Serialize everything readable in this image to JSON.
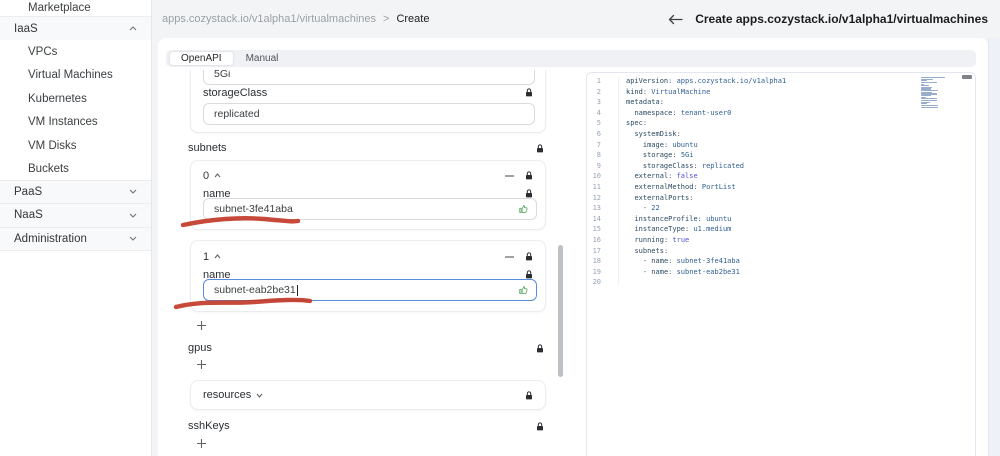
{
  "topbar": {
    "breadcrumb_path": "apps.cozystack.io/v1alpha1/virtualmachines",
    "breadcrumb_separator": ">",
    "breadcrumb_current": "Create",
    "back_icon": "arrow-left",
    "title": "Create apps.cozystack.io/v1alpha1/virtualmachines"
  },
  "sidebar": {
    "items": [
      {
        "label": "Marketplace",
        "kind": "item",
        "divider": true
      },
      {
        "label": "IaaS",
        "kind": "section",
        "chevron": "up",
        "divider": false
      },
      {
        "label": "VPCs",
        "kind": "item",
        "divider": false
      },
      {
        "label": "Virtual Machines",
        "kind": "item",
        "divider": false
      },
      {
        "label": "Kubernetes",
        "kind": "item",
        "divider": false
      },
      {
        "label": "VM Instances",
        "kind": "item",
        "divider": false
      },
      {
        "label": "VM Disks",
        "kind": "item",
        "divider": false
      },
      {
        "label": "Buckets",
        "kind": "item",
        "divider": true
      },
      {
        "label": "PaaS",
        "kind": "section",
        "chevron": "down",
        "divider": true
      },
      {
        "label": "NaaS",
        "kind": "section",
        "chevron": "down",
        "divider": true
      },
      {
        "label": "Administration",
        "kind": "section",
        "chevron": "down",
        "divider": true
      }
    ]
  },
  "tabs": [
    {
      "label": "OpenAPI",
      "active": true
    },
    {
      "label": "Manual",
      "active": false
    }
  ],
  "form": {
    "storage_partial_value": "5Gi",
    "storage_class_label": "storageClass",
    "storage_class_value": "replicated",
    "subnets_label": "subnets",
    "subnet_items": [
      {
        "index": "0",
        "field_label": "name",
        "value": "subnet-3fe41aba",
        "focused": false
      },
      {
        "index": "1",
        "field_label": "name",
        "value": "subnet-eab2be31",
        "focused": true
      }
    ],
    "gpus_label": "gpus",
    "resources_label": "resources",
    "sshkeys_label": "sshKeys",
    "add_icon": "plus",
    "remove_icon": "minus",
    "lock_icon": "padlock",
    "approve_icon": "thumbs-up"
  },
  "editor": {
    "lines": [
      {
        "n": "1",
        "tokens": [
          [
            "k",
            "apiVersion"
          ],
          [
            "p",
            ": "
          ],
          [
            "s",
            "apps.cozystack.io/v1alpha1"
          ]
        ]
      },
      {
        "n": "2",
        "tokens": [
          [
            "k",
            "kind"
          ],
          [
            "p",
            ": "
          ],
          [
            "s",
            "VirtualMachine"
          ]
        ]
      },
      {
        "n": "3",
        "tokens": [
          [
            "k",
            "metadata"
          ],
          [
            "p",
            ":"
          ]
        ]
      },
      {
        "n": "4",
        "tokens": [
          [
            "w",
            "  "
          ],
          [
            "k",
            "namespace"
          ],
          [
            "p",
            ": "
          ],
          [
            "s",
            "tenant-user0"
          ]
        ]
      },
      {
        "n": "5",
        "tokens": [
          [
            "k",
            "spec"
          ],
          [
            "p",
            ":"
          ]
        ]
      },
      {
        "n": "6",
        "tokens": [
          [
            "w",
            "  "
          ],
          [
            "k",
            "systemDisk"
          ],
          [
            "p",
            ":"
          ]
        ]
      },
      {
        "n": "7",
        "tokens": [
          [
            "w",
            "    "
          ],
          [
            "k",
            "image"
          ],
          [
            "p",
            ": "
          ],
          [
            "s",
            "ubuntu"
          ]
        ]
      },
      {
        "n": "8",
        "tokens": [
          [
            "w",
            "    "
          ],
          [
            "k",
            "storage"
          ],
          [
            "p",
            ": "
          ],
          [
            "s",
            "5Gi"
          ]
        ]
      },
      {
        "n": "9",
        "tokens": [
          [
            "w",
            "    "
          ],
          [
            "k",
            "storageClass"
          ],
          [
            "p",
            ": "
          ],
          [
            "s",
            "replicated"
          ]
        ]
      },
      {
        "n": "10",
        "tokens": [
          [
            "w",
            "  "
          ],
          [
            "k",
            "external"
          ],
          [
            "p",
            ": "
          ],
          [
            "b",
            "false"
          ]
        ]
      },
      {
        "n": "11",
        "tokens": [
          [
            "w",
            "  "
          ],
          [
            "k",
            "externalMethod"
          ],
          [
            "p",
            ": "
          ],
          [
            "s",
            "PortList"
          ]
        ]
      },
      {
        "n": "12",
        "tokens": [
          [
            "w",
            "  "
          ],
          [
            "k",
            "externalPorts"
          ],
          [
            "p",
            ":"
          ]
        ]
      },
      {
        "n": "13",
        "tokens": [
          [
            "w",
            "    "
          ],
          [
            "p",
            "- "
          ],
          [
            "n",
            "22"
          ]
        ]
      },
      {
        "n": "14",
        "tokens": [
          [
            "w",
            "  "
          ],
          [
            "k",
            "instanceProfile"
          ],
          [
            "p",
            ": "
          ],
          [
            "s",
            "ubuntu"
          ]
        ]
      },
      {
        "n": "15",
        "tokens": [
          [
            "w",
            "  "
          ],
          [
            "k",
            "instanceType"
          ],
          [
            "p",
            ": "
          ],
          [
            "s",
            "u1.medium"
          ]
        ]
      },
      {
        "n": "16",
        "tokens": [
          [
            "w",
            "  "
          ],
          [
            "k",
            "running"
          ],
          [
            "p",
            ": "
          ],
          [
            "b",
            "true"
          ]
        ]
      },
      {
        "n": "17",
        "tokens": [
          [
            "w",
            "  "
          ],
          [
            "k",
            "subnets"
          ],
          [
            "p",
            ":"
          ]
        ]
      },
      {
        "n": "18",
        "tokens": [
          [
            "w",
            "    "
          ],
          [
            "p",
            "- "
          ],
          [
            "k",
            "name"
          ],
          [
            "p",
            ": "
          ],
          [
            "s",
            "subnet-3fe41aba"
          ]
        ]
      },
      {
        "n": "19",
        "tokens": [
          [
            "w",
            "    "
          ],
          [
            "p",
            "- "
          ],
          [
            "k",
            "name"
          ],
          [
            "p",
            ": "
          ],
          [
            "s",
            "subnet-eab2be31"
          ]
        ]
      },
      {
        "n": "20",
        "tokens": []
      }
    ]
  },
  "colors": {
    "annotation_red": "#c23a28",
    "focus_blue": "#5a8bdb",
    "thumb_green": "#56a456",
    "key_blue": "#2c4a63",
    "value_blue": "#2f5f93",
    "bool_indigo": "#5551d6"
  }
}
